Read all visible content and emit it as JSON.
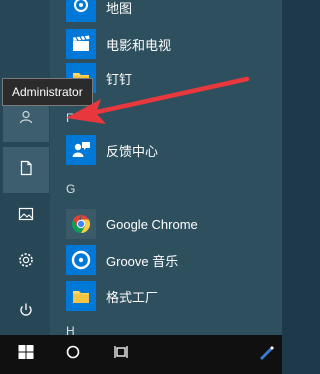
{
  "tooltip": {
    "text": "Administrator"
  },
  "sections": {
    "f": "F",
    "g": "G",
    "h": "H"
  },
  "apps": {
    "maps": {
      "label": "地图",
      "icon": "map-pin-icon",
      "color": "#0078d7"
    },
    "movies": {
      "label": "电影和电视",
      "icon": "clapperboard-icon",
      "color": "#0078d7"
    },
    "pins": {
      "label": "钉钉",
      "icon": "folder-icon",
      "color": "#0078d7"
    },
    "feedback": {
      "label": "反馈中心",
      "icon": "feedback-person-icon",
      "color": "#0078d7"
    },
    "chrome": {
      "label": "Google Chrome",
      "icon": "chrome-icon",
      "color": "#2e4f5e"
    },
    "groove": {
      "label": "Groove 音乐",
      "icon": "groove-disc-icon",
      "color": "#0078d7"
    },
    "factory": {
      "label": "格式工厂",
      "icon": "folder-icon",
      "color": "#0078d7"
    }
  },
  "rail": [
    "user-icon",
    "document-icon",
    "pictures-icon",
    "settings-gear-icon",
    "power-icon"
  ],
  "taskbar": [
    "windows-start-icon",
    "cortana-circle-icon",
    "task-view-icon",
    "pen-workspace-icon"
  ],
  "colors": {
    "accent": "#0078d7",
    "arrow": "#e8383d",
    "menu_bg": "#2e4f5e",
    "taskbar_bg": "#101010"
  }
}
